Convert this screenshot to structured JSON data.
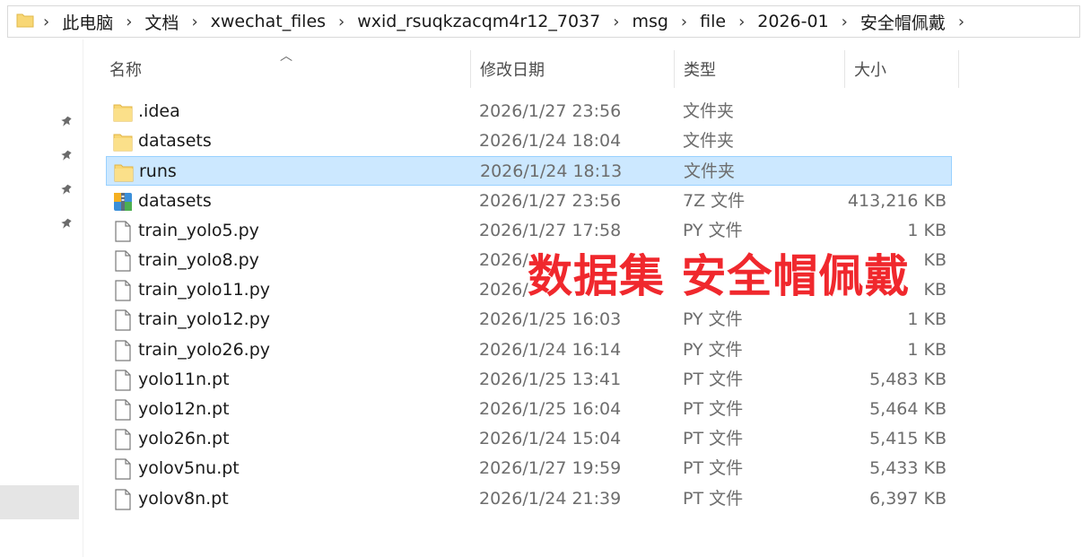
{
  "address_bar": {
    "breadcrumbs": [
      "此电脑",
      "文档",
      "xwechat_files",
      "wxid_rsuqkzacqm4r12_7037",
      "msg",
      "file",
      "2026-01",
      "安全帽佩戴"
    ]
  },
  "columns": {
    "name": "名称",
    "date": "修改日期",
    "type": "类型",
    "size": "大小"
  },
  "files": [
    {
      "name": ".idea",
      "date": "2026/1/27 23:56",
      "type": "文件夹",
      "size": "",
      "icon": "folder-icon"
    },
    {
      "name": "datasets",
      "date": "2026/1/24 18:04",
      "type": "文件夹",
      "size": "",
      "icon": "folder-icon"
    },
    {
      "name": "runs",
      "date": "2026/1/24 18:13",
      "type": "文件夹",
      "size": "",
      "icon": "folder-icon",
      "selected": true
    },
    {
      "name": "datasets",
      "date": "2026/1/27 23:56",
      "type": "7Z 文件",
      "size": "413,216 KB",
      "icon": "archive-icon"
    },
    {
      "name": "train_yolo5.py",
      "date": "2026/1/27 17:58",
      "type": "PY 文件",
      "size": "1 KB",
      "icon": "file-icon"
    },
    {
      "name": "train_yolo8.py",
      "date": "2026/",
      "type": "",
      "size": "KB",
      "icon": "file-icon"
    },
    {
      "name": "train_yolo11.py",
      "date": "2026/",
      "type": "",
      "size": "KB",
      "icon": "file-icon"
    },
    {
      "name": "train_yolo12.py",
      "date": "2026/1/25 16:03",
      "type": "PY 文件",
      "size": "1 KB",
      "icon": "file-icon"
    },
    {
      "name": "train_yolo26.py",
      "date": "2026/1/24 16:14",
      "type": "PY 文件",
      "size": "1 KB",
      "icon": "file-icon"
    },
    {
      "name": "yolo11n.pt",
      "date": "2026/1/25 13:41",
      "type": "PT 文件",
      "size": "5,483 KB",
      "icon": "file-icon"
    },
    {
      "name": "yolo12n.pt",
      "date": "2026/1/25 16:04",
      "type": "PT 文件",
      "size": "5,464 KB",
      "icon": "file-icon"
    },
    {
      "name": "yolo26n.pt",
      "date": "2026/1/24 15:04",
      "type": "PT 文件",
      "size": "5,415 KB",
      "icon": "file-icon"
    },
    {
      "name": "yolov5nu.pt",
      "date": "2026/1/27 19:59",
      "type": "PT 文件",
      "size": "5,433 KB",
      "icon": "file-icon"
    },
    {
      "name": "yolov8n.pt",
      "date": "2026/1/24 21:39",
      "type": "PT 文件",
      "size": "6,397 KB",
      "icon": "file-icon"
    }
  ],
  "overlay_text": "数据集 安全帽佩戴",
  "colors": {
    "selection_bg": "#cce8ff",
    "selection_border": "#99d1ff",
    "folder_yellow": "#f8d775",
    "overlay_red": "#f0282d"
  }
}
